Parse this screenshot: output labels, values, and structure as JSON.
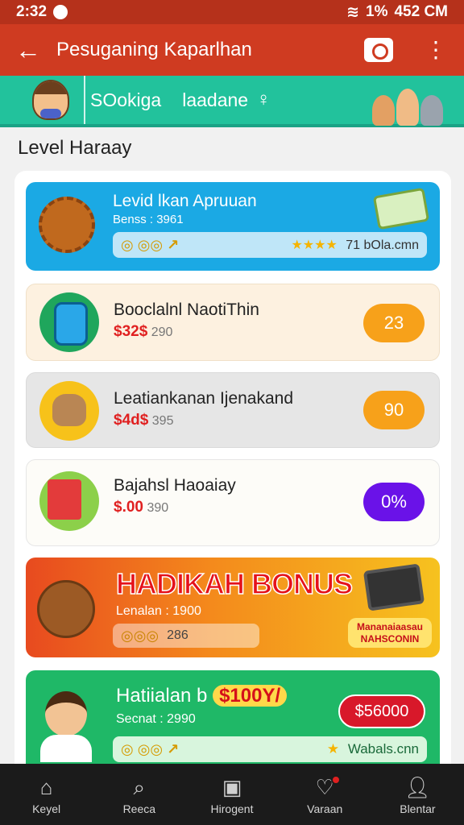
{
  "status": {
    "time": "2:32",
    "battery": "1%",
    "right_time": "452 CM"
  },
  "appbar": {
    "title": "Pesuganing Kaparlhan",
    "back_icon": "arrow-left-icon",
    "camera_icon": "camera-icon",
    "more_icon": "more-vertical-icon"
  },
  "banner": {
    "label1": "SOokiga",
    "label2": "laadane"
  },
  "section": {
    "title": "Level Haraay"
  },
  "cards": [
    {
      "name": "Levid lkan Apruuan",
      "sub": "Benss : 3961",
      "coins": "◎ ◎◎ ↗",
      "stars": "★★★★",
      "site": "71 bOla.cmn"
    },
    {
      "name": "Booclalnl NaotiThin",
      "price": "$32$",
      "extra": "290",
      "badge": "23"
    },
    {
      "name": "Leatiankanan Ijenakand",
      "price": "$4d$",
      "extra": "395",
      "badge": "90"
    },
    {
      "name": "Bajahsl Haoaiay",
      "price": "$.00",
      "extra": "390",
      "badge": "0%"
    },
    {
      "name": "HADIKAH BONUS",
      "sub": "Lenalan : 1900",
      "coins": "◎◎◎",
      "value": "286",
      "promo": "Mananaiaasau NAHSCONIN"
    },
    {
      "name": "Hatiialan b",
      "pill": "$100Y/",
      "sub": "Secnat : 2990",
      "price": "$56000",
      "coins": "◎ ◎◎ ↗",
      "site": "Wabals.cnn"
    }
  ],
  "nav": [
    {
      "label": "Keyel",
      "icon": "home-icon"
    },
    {
      "label": "Reeca",
      "icon": "search-icon"
    },
    {
      "label": "Hirogent",
      "icon": "screen-icon"
    },
    {
      "label": "Varaan",
      "icon": "heart-icon"
    },
    {
      "label": "Blentar",
      "icon": "user-icon"
    }
  ],
  "colors": {
    "appbar": "#cf3b21",
    "banner": "#22c29c",
    "nav": "#1b1b1b"
  }
}
